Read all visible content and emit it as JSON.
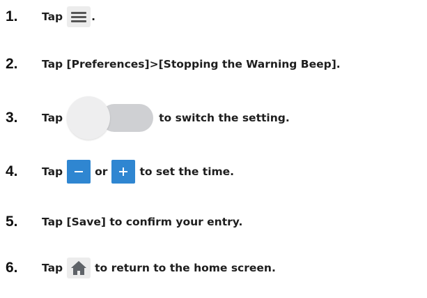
{
  "steps": [
    {
      "number": "1.",
      "pre": "Tap",
      "post": ".",
      "icon": "menu-icon"
    },
    {
      "number": "2.",
      "text": "Tap [Preferences]>[Stopping the Warning Beep]."
    },
    {
      "number": "3.",
      "pre": "Tap",
      "post": "to switch the setting.",
      "icon": "toggle-switch"
    },
    {
      "number": "4.",
      "pre": "Tap",
      "mid": "or",
      "post": "to set the time.",
      "icons": [
        "minus-icon",
        "plus-icon"
      ]
    },
    {
      "number": "5.",
      "text": "Tap [Save] to confirm your entry."
    },
    {
      "number": "6.",
      "pre": "Tap",
      "post": "to return to the home screen.",
      "icon": "home-icon"
    }
  ],
  "colors": {
    "button_blue": "#2f86d1",
    "icon_bg": "#ececec",
    "toggle_track": "#cfd0d3",
    "toggle_thumb": "#eeeeef",
    "home_icon": "#5f6368"
  }
}
